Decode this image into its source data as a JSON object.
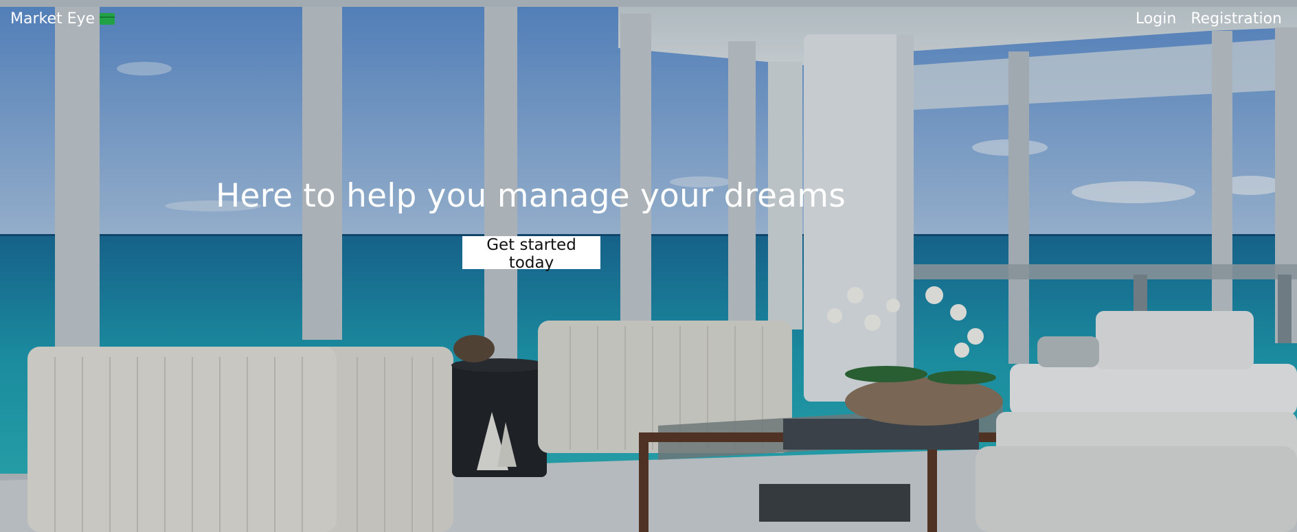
{
  "nav": {
    "brand": "Market Eye",
    "brand_icon": "money-icon",
    "links": [
      "Login",
      "Registration"
    ]
  },
  "hero": {
    "headline": "Here to help you manage your dreams",
    "cta_label": "Get started today",
    "background": "luxury-living-room-ocean-view-photo"
  },
  "colors": {
    "brand_icon": "#22a146",
    "nav_text": "#ffffff",
    "cta_background": "#ffffff",
    "cta_text": "#111111"
  }
}
